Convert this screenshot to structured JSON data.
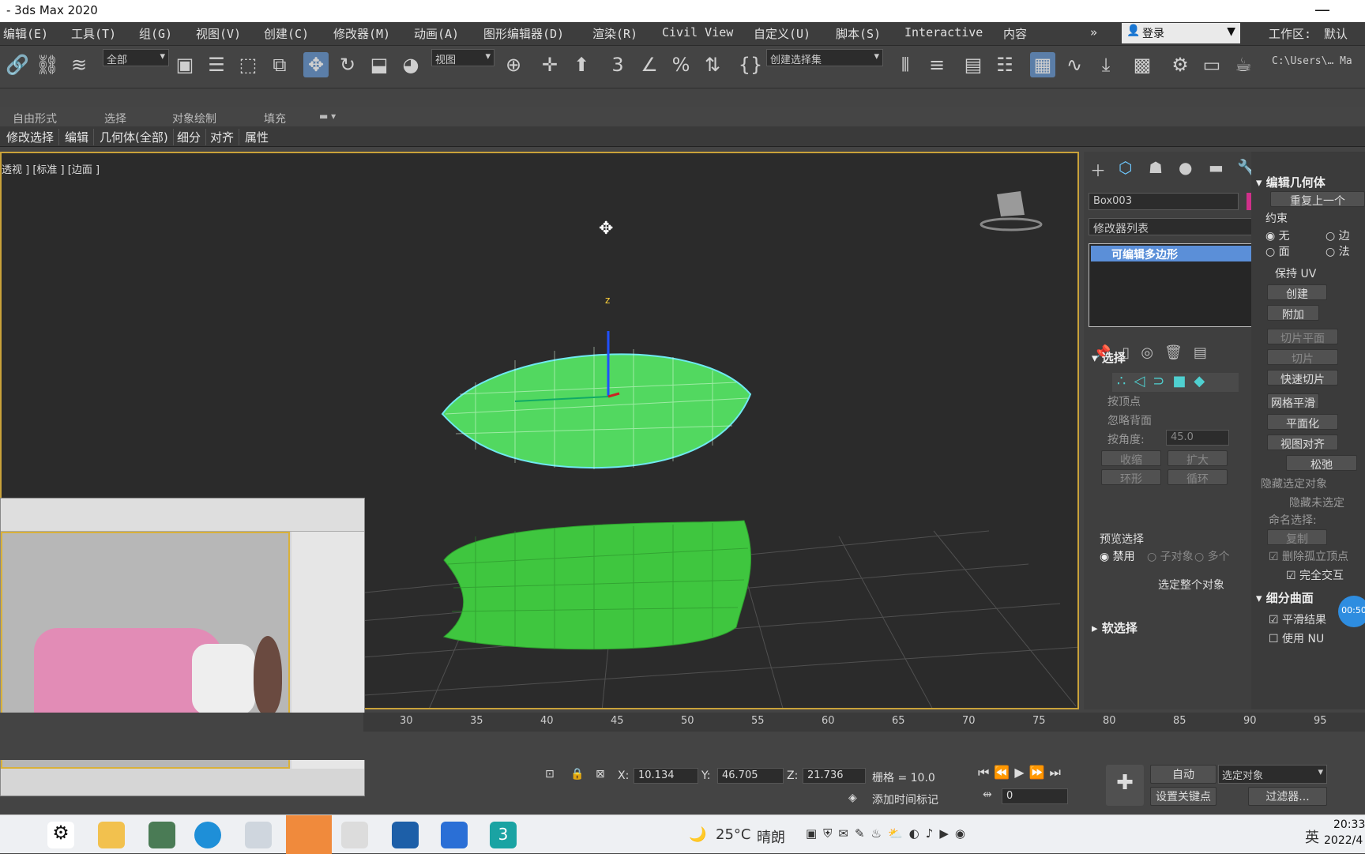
{
  "window": {
    "title": "- 3ds Max 2020",
    "minimize": "—"
  },
  "menubar": {
    "items": [
      "编辑(E)",
      "工具(T)",
      "组(G)",
      "视图(V)",
      "创建(C)",
      "修改器(M)",
      "动画(A)",
      "图形编辑器(D)",
      "渲染(R)",
      "Civil View",
      "自定义(U)",
      "脚本(S)",
      "Interactive",
      "内容"
    ],
    "overflow": "»",
    "login": "登录",
    "workspace_label": "工作区:",
    "workspace_value": "默认"
  },
  "toolbar": {
    "selection_filter": "全部",
    "ref_coord": "视图",
    "selection_set": "创建选择集",
    "path": "C:\\Users\\… Ma"
  },
  "ribbon": {
    "tabs": [
      "自由形式",
      "选择",
      "对象绘制",
      "填充"
    ],
    "subtabs": [
      "修改选择",
      "编辑",
      "几何体(全部)",
      "细分",
      "对齐",
      "属性"
    ]
  },
  "viewport": {
    "label": "透视 ] [标准 ] [边面 ]",
    "gizmo_axis": "z"
  },
  "command_panel": {
    "object_name": "Box003",
    "object_color": "#d0308a",
    "modifier_list": "修改器列表",
    "stack_item": "可编辑多边形",
    "selection": {
      "title": "选择",
      "by_vertex": "按顶点",
      "ignore_backface": "忽略背面",
      "by_angle": "按角度:",
      "angle_value": "45.0",
      "shrink": "收缩",
      "grow": "扩大",
      "ring": "环形",
      "loop": "循环",
      "preview_label": "预览选择",
      "disabled": "禁用",
      "subobject": "子对象",
      "multi": "多个",
      "select_whole": "选定整个对象"
    },
    "soft_selection": "软选择",
    "edit_geometry": {
      "title": "编辑几何体",
      "repeat": "重复上一个",
      "constraints": "约束",
      "none": "无",
      "edge": "边",
      "face": "面",
      "normal": "法",
      "preserve_uv": "保持 UV",
      "create": "创建",
      "attach": "附加",
      "slice_plane": "切片平面",
      "slice": "切片",
      "quick_slice": "快速切片",
      "meshsmooth": "网格平滑",
      "planarize": "平面化",
      "view_align": "视图对齐",
      "relax": "松弛",
      "hide_selected": "隐藏选定对象",
      "hide_unselected": "隐藏未选定",
      "named_sel": "命名选择:",
      "copy": "复制",
      "delete_iso": "删除孤立顶点",
      "full_interact": "完全交互"
    },
    "subdivision": {
      "title": "细分曲面",
      "smooth_result": "平滑结果",
      "use_nurms": "使用 NU"
    },
    "timer": "00:50"
  },
  "timeline": {
    "ticks": [
      "30",
      "35",
      "40",
      "45",
      "50",
      "55",
      "60",
      "65",
      "70",
      "75",
      "80",
      "85",
      "90",
      "95"
    ]
  },
  "status": {
    "x_label": "X:",
    "x": "10.134",
    "y_label": "Y:",
    "y": "46.705",
    "z_label": "Z:",
    "z": "21.736",
    "grid": "栅格 = 10.0",
    "add_tag": "添加时间标记",
    "auto": "自动",
    "set_key": "设置关键点",
    "selected": "选定对象",
    "filters": "过滤器...",
    "frame": "0"
  },
  "taskbar": {
    "weather_temp": "25°C",
    "weather_text": "晴朗",
    "lang": "英",
    "time": "20:33",
    "date": "2022/4"
  }
}
